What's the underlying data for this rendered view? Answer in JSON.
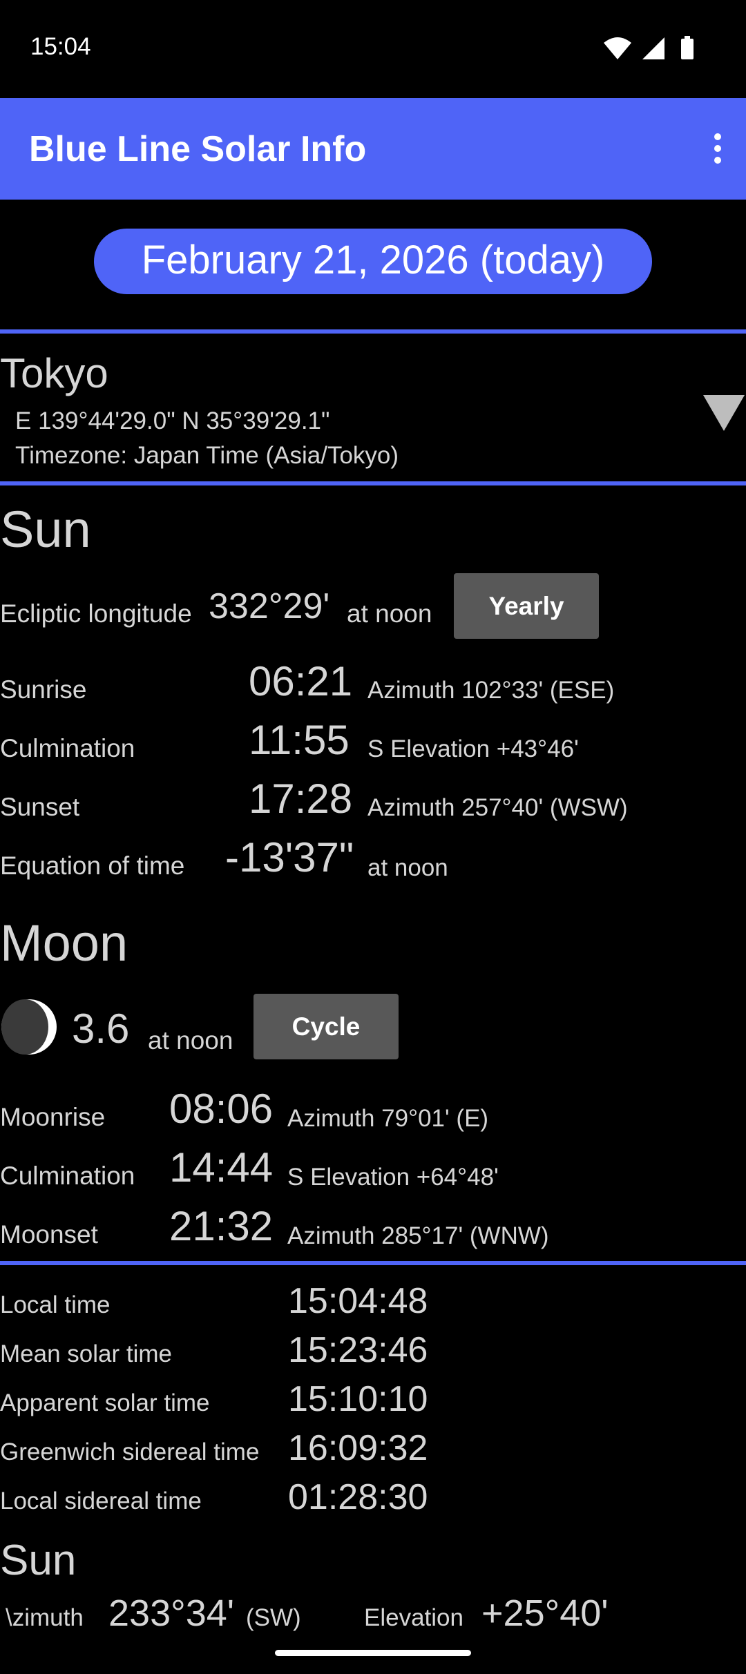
{
  "status_bar": {
    "time": "15:04"
  },
  "app_bar": {
    "title": "Blue Line Solar Info"
  },
  "date_label": "February 21, 2026 (today)",
  "location": {
    "name": "Tokyo",
    "coords": "E 139°44'29.0\" N 35°39'29.1\"",
    "timezone": "Timezone: Japan Time (Asia/Tokyo)"
  },
  "sun": {
    "heading": "Sun",
    "ecliptic_label": "Ecliptic longitude",
    "ecliptic_value": "332°29'",
    "ecliptic_suffix": "at noon",
    "yearly_button": "Yearly",
    "rows": [
      {
        "label": "Sunrise",
        "time": "06:21",
        "detail": "Azimuth 102°33' (ESE)"
      },
      {
        "label": "Culmination",
        "time": "11:55",
        "detail": "S Elevation +43°46'"
      },
      {
        "label": "Sunset",
        "time": "17:28",
        "detail": "Azimuth 257°40' (WSW)"
      },
      {
        "label": "Equation of time",
        "time": "-13'37\"",
        "detail": "at noon"
      }
    ]
  },
  "moon": {
    "heading": "Moon",
    "age": "3.6",
    "age_suffix": "at noon",
    "cycle_button": "Cycle",
    "rows": [
      {
        "label": "Moonrise",
        "time": "08:06",
        "detail": "Azimuth 79°01' (E)"
      },
      {
        "label": "Culmination",
        "time": "14:44",
        "detail": "S Elevation +64°48'"
      },
      {
        "label": "Moonset",
        "time": "21:32",
        "detail": "Azimuth 285°17' (WNW)"
      }
    ]
  },
  "times": [
    {
      "label": "Local time",
      "value": "15:04:48"
    },
    {
      "label": "Mean solar time",
      "value": "15:23:46"
    },
    {
      "label": "Apparent solar time",
      "value": "15:10:10"
    },
    {
      "label": "Greenwich sidereal time",
      "value": "16:09:32"
    },
    {
      "label": "Local sidereal time",
      "value": "01:28:30"
    }
  ],
  "sun_position": {
    "heading": "Sun",
    "azimuth_label": "\\zimuth",
    "azimuth_value": "233°34'",
    "azimuth_dir": "(SW)",
    "elevation_label": "Elevation",
    "elevation_value": "+25°40'"
  },
  "colors": {
    "accent": "#4f64f7",
    "background": "#000000",
    "text": "#d6d6d6",
    "button": "#585858"
  }
}
